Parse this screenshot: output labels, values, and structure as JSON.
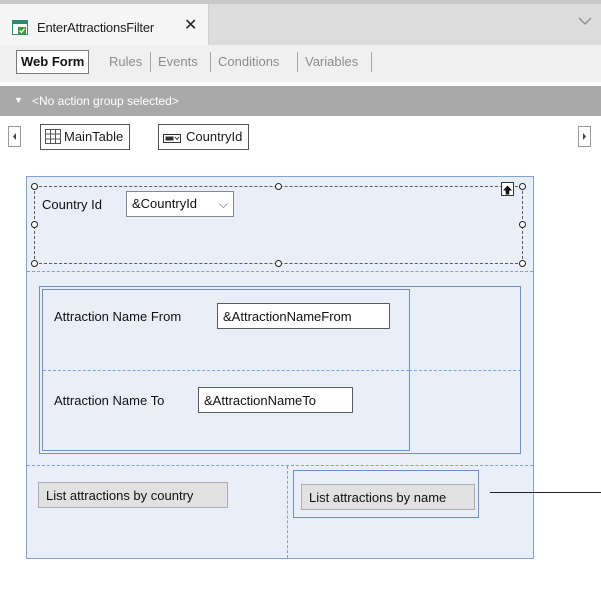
{
  "document_tab": {
    "title": "EnterAttractionsFilter",
    "close_glyph": "✕",
    "icon": "webpanel-icon"
  },
  "tab_overflow_icon": "chevron-down-icon",
  "sub_tabs": [
    {
      "label": "Web Form",
      "active": true
    },
    {
      "label": "Rules",
      "active": false
    },
    {
      "label": "Events",
      "active": false
    },
    {
      "label": "Conditions",
      "active": false
    },
    {
      "label": "Variables",
      "active": false
    }
  ],
  "action_group": {
    "caret": "▼",
    "label": "<No action group selected>"
  },
  "breadcrumb": {
    "items": [
      {
        "label": "MainTable",
        "icon": "table-icon"
      },
      {
        "label": "CountryId",
        "icon": "combo-icon"
      }
    ]
  },
  "form": {
    "country_label": "Country Id",
    "country_combo_value": "&CountryId",
    "attraction_from_label": "Attraction Name From",
    "attraction_from_value": "&AttractionNameFrom",
    "attraction_to_label": "Attraction Name To",
    "attraction_to_value": "&AttractionNameTo",
    "btn_by_country": "List attractions by country",
    "btn_by_name": "List attractions by name"
  },
  "colors": {
    "accent_border": "#7fa3d6",
    "canvas_fill": "#e9eef9",
    "action_bar": "#a9a9a9"
  }
}
